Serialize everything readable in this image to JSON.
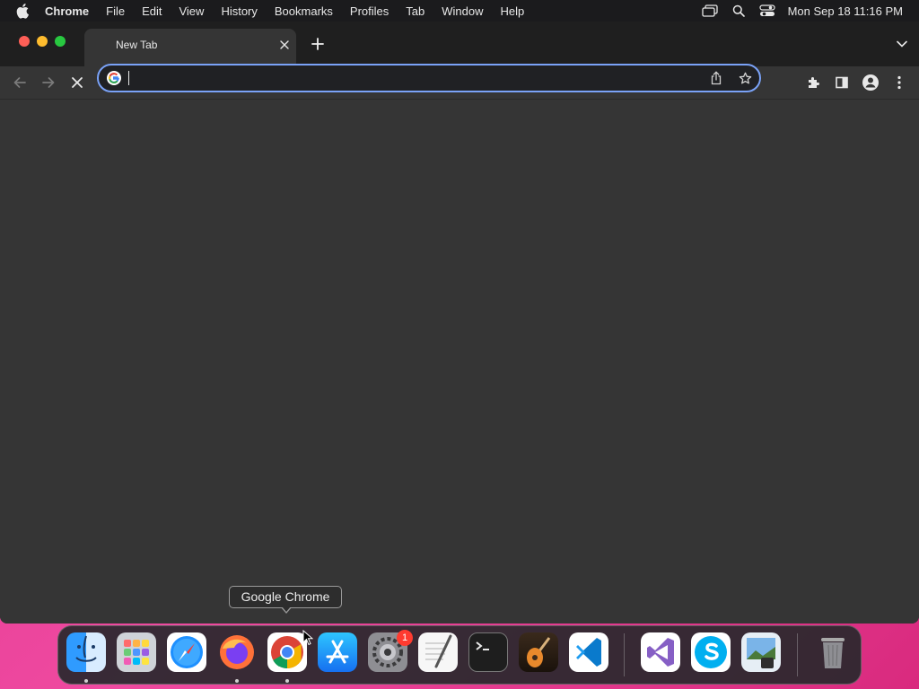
{
  "menubar": {
    "app_name": "Chrome",
    "items": [
      "File",
      "Edit",
      "View",
      "History",
      "Bookmarks",
      "Profiles",
      "Tab",
      "Window",
      "Help"
    ],
    "clock": "Mon Sep 18  11:16 PM",
    "status_icons": [
      "screen-mirroring-icon",
      "spotlight-search-icon",
      "control-center-icon"
    ]
  },
  "browser": {
    "tab": {
      "title": "New Tab"
    },
    "omnibox": {
      "value": "",
      "placeholder": ""
    },
    "accent_color": "#7aa2f7",
    "toolbar_icons": [
      "back-icon",
      "forward-icon",
      "stop-loading-icon",
      "share-icon",
      "bookmark-star-icon",
      "extensions-icon",
      "side-panel-icon",
      "profile-icon",
      "menu-icon"
    ]
  },
  "tooltip": {
    "text": "Google Chrome"
  },
  "dock": {
    "apps": [
      "Finder",
      "Launchpad",
      "Safari",
      "Firefox",
      "Google Chrome",
      "App Store",
      "System Settings",
      "TextEdit",
      "Terminal",
      "GarageBand",
      "Visual Studio Code",
      "Visual Studio",
      "Skype",
      "Preview",
      "Trash"
    ],
    "system_settings_badge": "1"
  }
}
